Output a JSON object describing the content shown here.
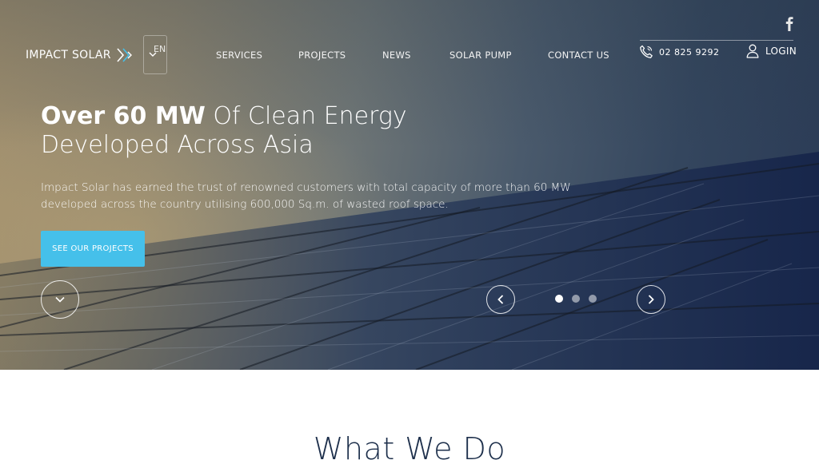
{
  "brand": {
    "name": "IMPACT SOLAR",
    "accent": "#45c0ea"
  },
  "language": {
    "current": "EN"
  },
  "nav": {
    "items": [
      {
        "label": "SERVICES"
      },
      {
        "label": "PROJECTS"
      },
      {
        "label": "NEWS"
      },
      {
        "label": "SOLAR PUMP"
      },
      {
        "label": "CONTACT US"
      }
    ]
  },
  "contact": {
    "phone": "02 825 9292",
    "login_label": "LOGIN",
    "social": "facebook-icon"
  },
  "hero": {
    "headline_bold": "Over 60 MW",
    "headline_rest": " Of Clean Energy",
    "headline_line2": "Developed Across Asia",
    "subtext": "Impact Solar has earned the trust of renowned customers with total capacity of more than 60 MW developed across the country utilising 600,000 Sq.m. of wasted roof space.",
    "cta_label": "SEE OUR PROJECTS",
    "slides": {
      "count": 3,
      "active": 1
    }
  },
  "section": {
    "title": "What We Do"
  }
}
